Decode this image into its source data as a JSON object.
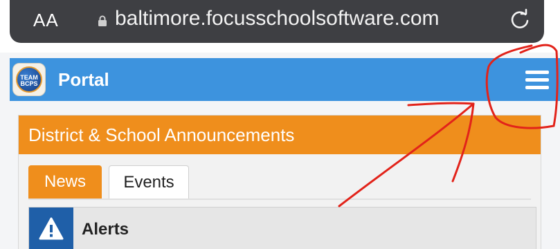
{
  "browser": {
    "text_size_label": "AA",
    "url": "baltimore.focusschoolsoftware.com",
    "lock_icon": "lock-icon",
    "reload_icon": "reload-icon"
  },
  "portal": {
    "logo_text_line1": "TEAM",
    "logo_text_line2": "BCPS",
    "title": "Portal",
    "menu_icon": "hamburger-menu-icon",
    "header_color": "#3d93de"
  },
  "announcements": {
    "title": "District & School Announcements",
    "header_color": "#ef8e1c",
    "tabs": [
      {
        "label": "News",
        "active": true
      },
      {
        "label": "Events",
        "active": false
      }
    ],
    "items": [
      {
        "label": "Alerts",
        "icon": "warning-icon"
      }
    ]
  },
  "annotation": {
    "color": "#e2231a",
    "shapes": [
      "circle-around-menu",
      "arrow-to-menu"
    ]
  }
}
